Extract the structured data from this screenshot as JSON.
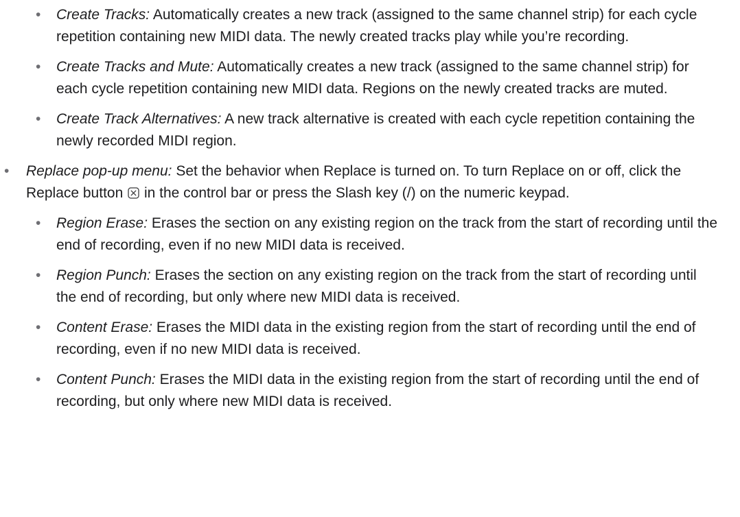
{
  "top_list": [
    {
      "term": "Create Tracks:",
      "text": " Automatically creates a new track (assigned to the same channel strip) for each cycle repetition containing new MIDI data. The newly created tracks play while you’re recording."
    },
    {
      "term": "Create Tracks and Mute:",
      "text": " Automatically creates a new track (assigned to the same channel strip) for each cycle repetition containing new MIDI data. Regions on the newly created tracks are muted."
    },
    {
      "term": "Create Track Alternatives:",
      "text": " A new track alternative is created with each cycle repetition containing the newly recorded MIDI region."
    }
  ],
  "replace_item": {
    "term": "Replace pop-up menu:",
    "text_before_icon": " Set the behavior when Replace is turned on. To turn Replace on or off, click the Replace button ",
    "icon": "replace-button-icon",
    "text_after_icon": " in the control bar or press the Slash key (/) on the numeric keypad."
  },
  "replace_list": [
    {
      "term": "Region Erase:",
      "text": " Erases the section on any existing region on the track from the start of recording until the end of recording, even if no new MIDI data is received."
    },
    {
      "term": "Region Punch:",
      "text": " Erases the section on any existing region on the track from the start of recording until the end of recording, but only where new MIDI data is received."
    },
    {
      "term": "Content Erase:",
      "text": " Erases the MIDI data in the existing region from the start of recording until the end of recording, even if no new MIDI data is received."
    },
    {
      "term": "Content Punch:",
      "text": " Erases the MIDI data in the existing region from the start of recording until the end of recording, but only where new MIDI data is received."
    }
  ],
  "bullet": "•"
}
